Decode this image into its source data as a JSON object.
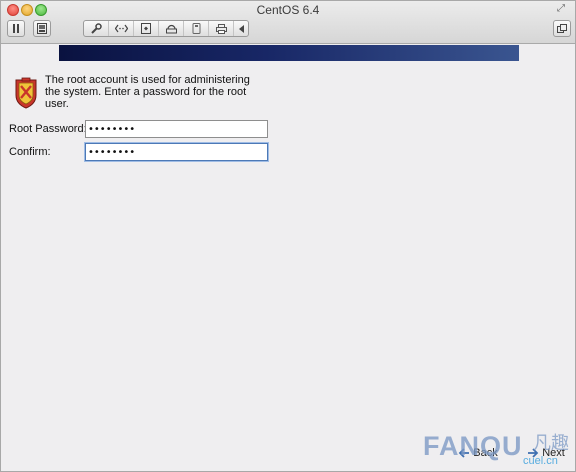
{
  "window": {
    "title": "CentOS 6.4"
  },
  "toolbar": {
    "icons": [
      "pause-icon",
      "snapshot-icon",
      "wrench-icon",
      "code-icon",
      "disk-icon",
      "hdd-icon",
      "usb-icon",
      "printer-icon",
      "chevron-left-icon"
    ]
  },
  "content": {
    "intro_text": "The root account is used for administering the system.  Enter a password for the root user.",
    "root_password_label": "Root Password:",
    "root_password_value": "••••••••",
    "confirm_label": "Confirm:",
    "confirm_value": "••••••••"
  },
  "navigation": {
    "back_label": "Back",
    "next_label": "Next"
  },
  "watermark": {
    "brand": "FANQU",
    "brand_cn": "凡趣",
    "url": "cuel.cn"
  },
  "colors": {
    "banner_dark": "#0a1240",
    "banner_light": "#3a5590",
    "focus_border": "#4d79b6"
  }
}
